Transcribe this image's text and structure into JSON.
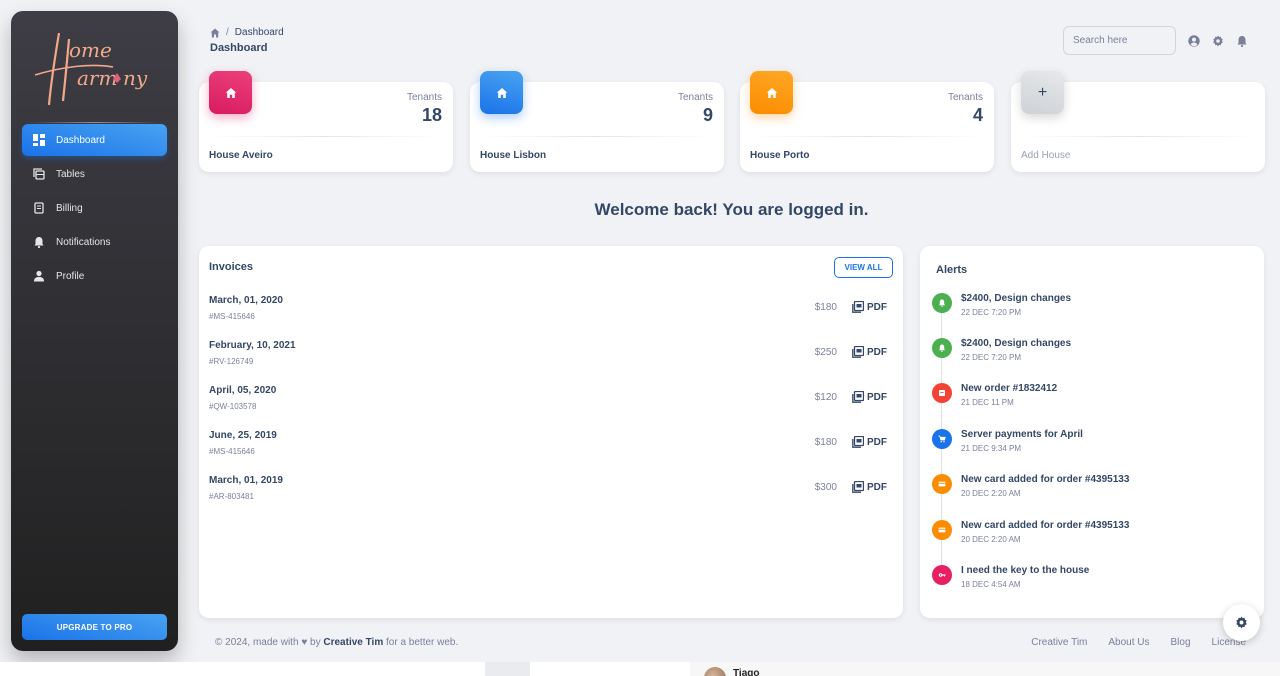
{
  "brand": {
    "logo_text_line1": "Home",
    "logo_text_line2": "Harmony"
  },
  "sidebar": {
    "items": [
      {
        "label": "Dashboard",
        "icon": "dashboard-icon",
        "active": true
      },
      {
        "label": "Tables",
        "icon": "table-icon"
      },
      {
        "label": "Billing",
        "icon": "receipt-icon"
      },
      {
        "label": "Notifications",
        "icon": "bell-icon"
      },
      {
        "label": "Profile",
        "icon": "person-icon"
      }
    ],
    "upgrade_label": "UPGRADE TO PRO"
  },
  "header": {
    "breadcrumb_current": "Dashboard",
    "breadcrumb_sep": "/",
    "title": "Dashboard",
    "search_placeholder": "Search here"
  },
  "houses": [
    {
      "name": "House Aveiro",
      "tenants_label": "Tenants",
      "tenants": "18",
      "color": "#e91e63"
    },
    {
      "name": "House Lisbon",
      "tenants_label": "Tenants",
      "tenants": "9",
      "color": "#1a73e8"
    },
    {
      "name": "House Porto",
      "tenants_label": "Tenants",
      "tenants": "4",
      "color": "#fb8c00"
    },
    {
      "name": "Add House",
      "plus": "+"
    }
  ],
  "welcome": "Welcome back! You are logged in.",
  "invoices": {
    "title": "Invoices",
    "view_all": "VIEW ALL",
    "rows": [
      {
        "date": "March, 01, 2020",
        "id": "#MS-415646",
        "amount": "$180",
        "pdf": "PDF"
      },
      {
        "date": "February, 10, 2021",
        "id": "#RV-126749",
        "amount": "$250",
        "pdf": "PDF"
      },
      {
        "date": "April, 05, 2020",
        "id": "#QW-103578",
        "amount": "$120",
        "pdf": "PDF"
      },
      {
        "date": "June, 25, 2019",
        "id": "#MS-415646",
        "amount": "$180",
        "pdf": "PDF"
      },
      {
        "date": "March, 01, 2019",
        "id": "#AR-803481",
        "amount": "$300",
        "pdf": "PDF"
      }
    ]
  },
  "alerts": {
    "title": "Alerts",
    "items": [
      {
        "title": "$2400, Design changes",
        "time": "22 DEC 7:20 PM",
        "color": "#4caf50",
        "icon": "bell-icon"
      },
      {
        "title": "$2400, Design changes",
        "time": "22 DEC 7:20 PM",
        "color": "#4caf50",
        "icon": "bell-icon"
      },
      {
        "title": "New order #1832412",
        "time": "21 DEC 11 PM",
        "color": "#f44335",
        "icon": "inventory-icon"
      },
      {
        "title": "Server payments for April",
        "time": "21 DEC 9:34 PM",
        "color": "#1a73e8",
        "icon": "cart-icon"
      },
      {
        "title": "New card added for order #4395133",
        "time": "20 DEC 2:20 AM",
        "color": "#fb8c00",
        "icon": "card-icon"
      },
      {
        "title": "New card added for order #4395133",
        "time": "20 DEC 2:20 AM",
        "color": "#fb8c00",
        "icon": "card-icon"
      },
      {
        "title": "I need the key to the house",
        "time": "18 DEC 4:54 AM",
        "color": "#e91e63",
        "icon": "key-icon"
      }
    ]
  },
  "footer": {
    "prefix": "© 2024, made with",
    "by": "by",
    "author": "Creative Tim",
    "suffix": "for a better web.",
    "links": [
      "Creative Tim",
      "About Us",
      "Blog",
      "License"
    ]
  },
  "taskbar": {
    "user_name": "Tiago"
  }
}
